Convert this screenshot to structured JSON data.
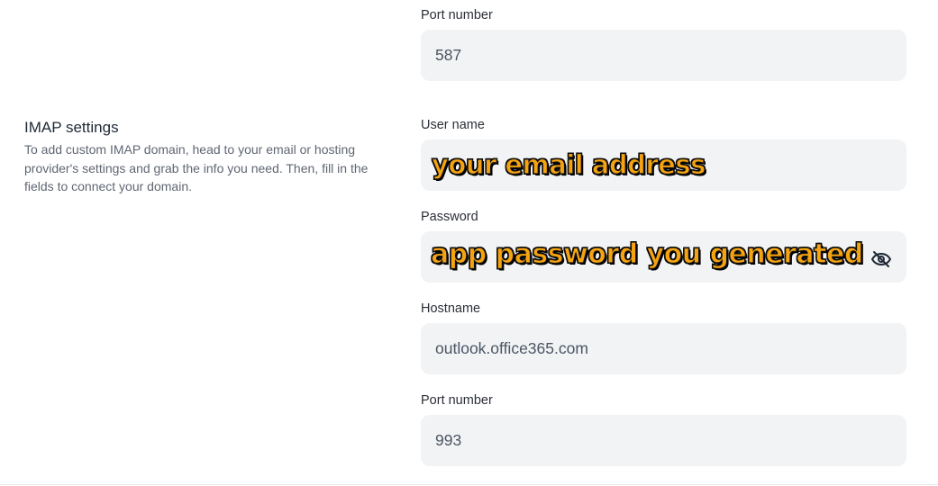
{
  "smtp": {
    "port_label": "Port number",
    "port_value": "587"
  },
  "imap": {
    "title": "IMAP settings",
    "description": "To add custom IMAP domain, head to your email or hosting provider's settings and grab the info you need. Then, fill in the fields to connect your domain.",
    "username_label": "User name",
    "username_value": "",
    "password_label": "Password",
    "password_value": "",
    "password_toggle_icon": "eye-off-icon",
    "hostname_label": "Hostname",
    "hostname_value": "outlook.office365.com",
    "port_label": "Port number",
    "port_value": "993"
  },
  "annotations": {
    "username_note": "your email address",
    "password_note": "app password you generated",
    "color": "#f5a310"
  }
}
